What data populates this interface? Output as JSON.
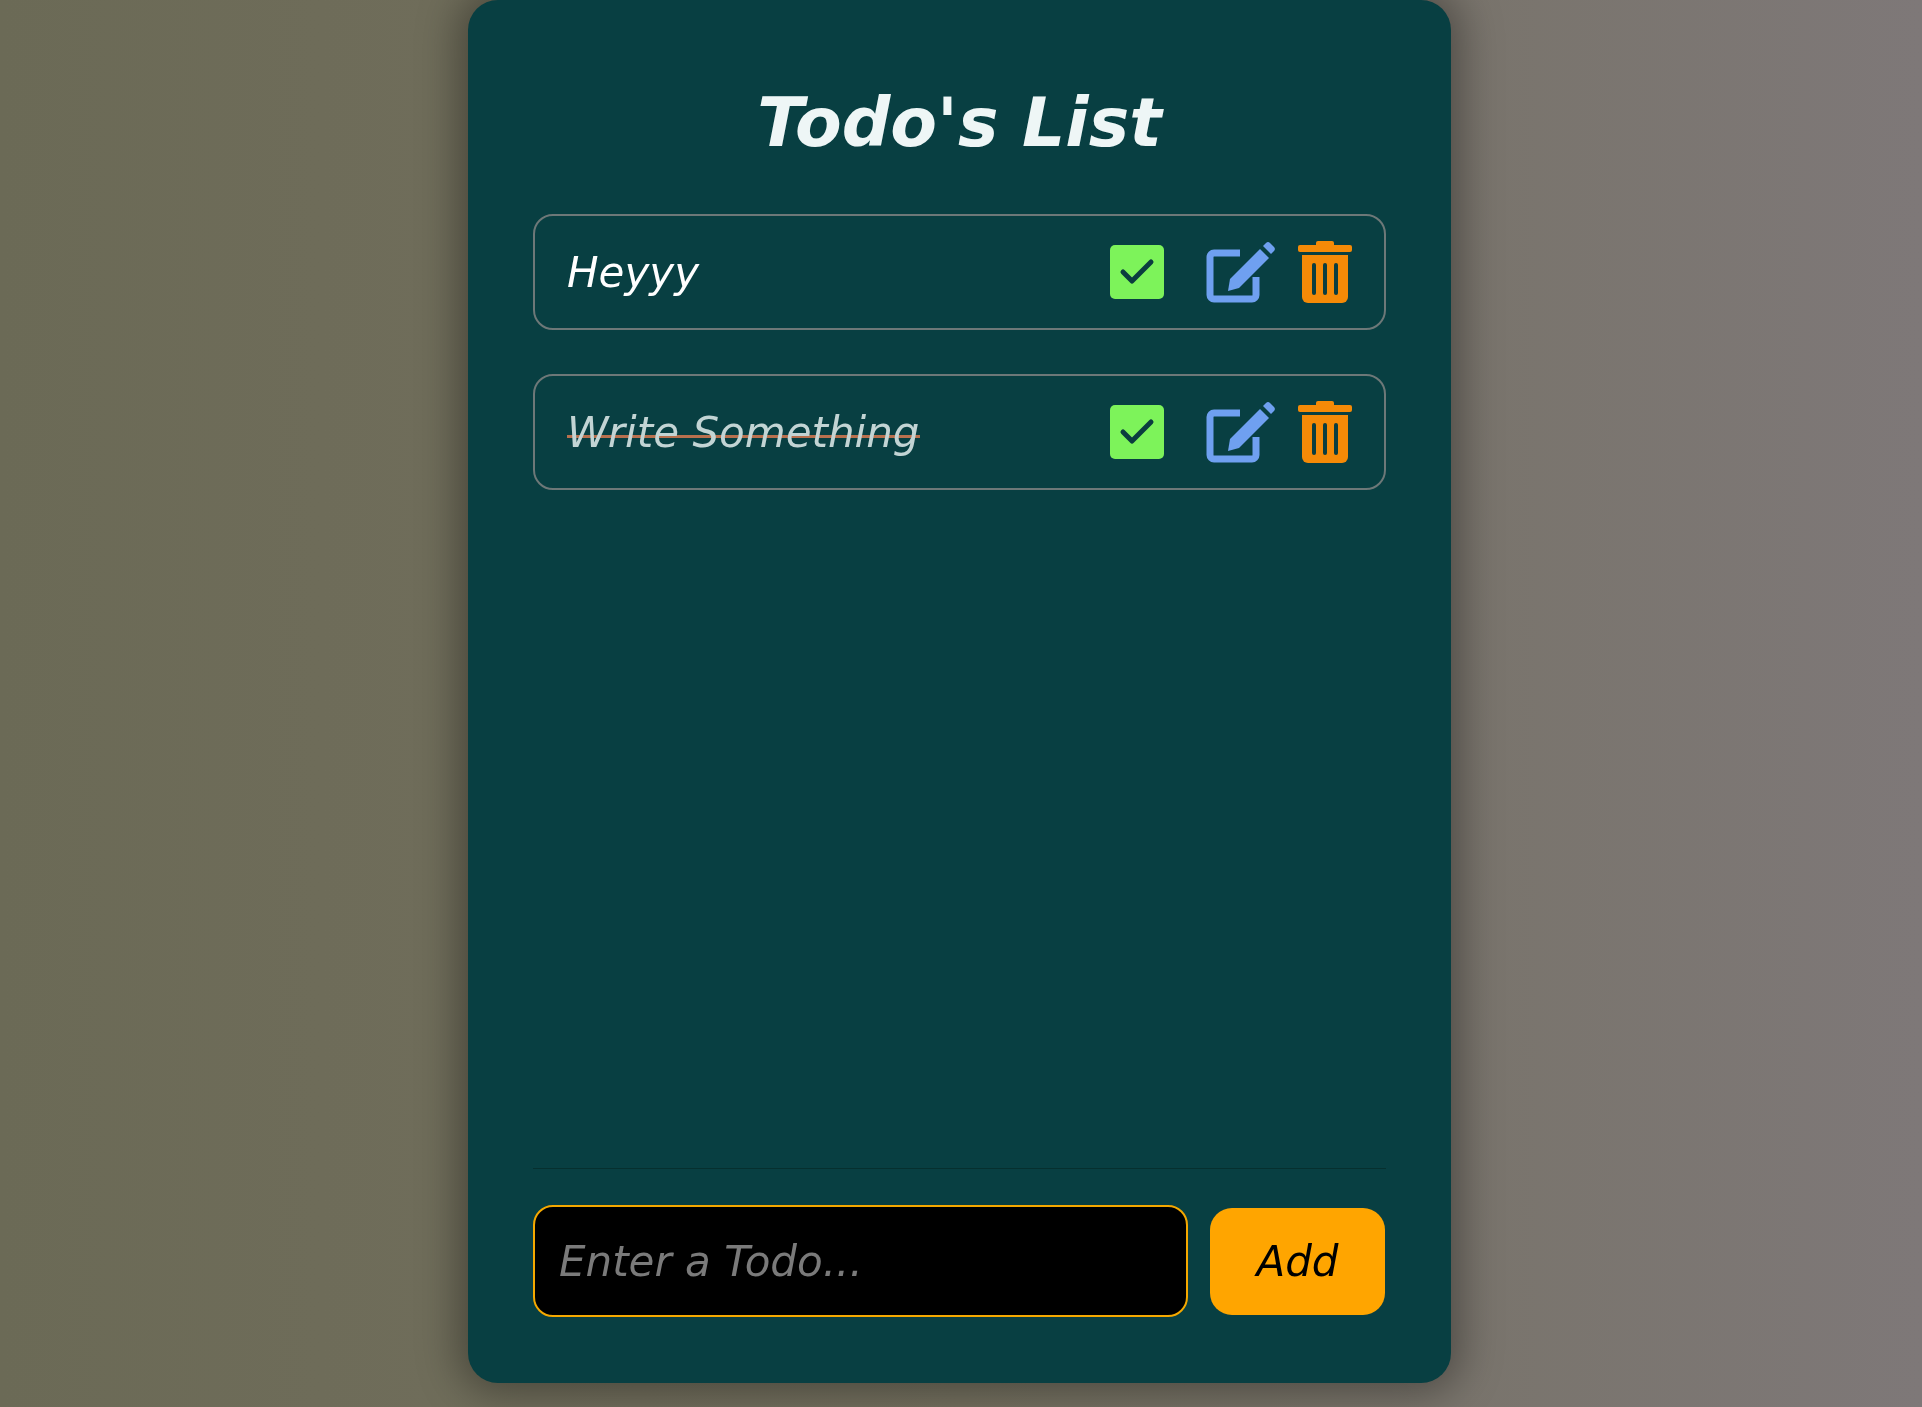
{
  "title": "Todo's List",
  "todos": [
    {
      "text": "Heyyy",
      "checked": true,
      "done": false
    },
    {
      "text": "Write Something",
      "checked": true,
      "done": true
    }
  ],
  "input": {
    "placeholder": "Enter a Todo..."
  },
  "add_button": "Add"
}
